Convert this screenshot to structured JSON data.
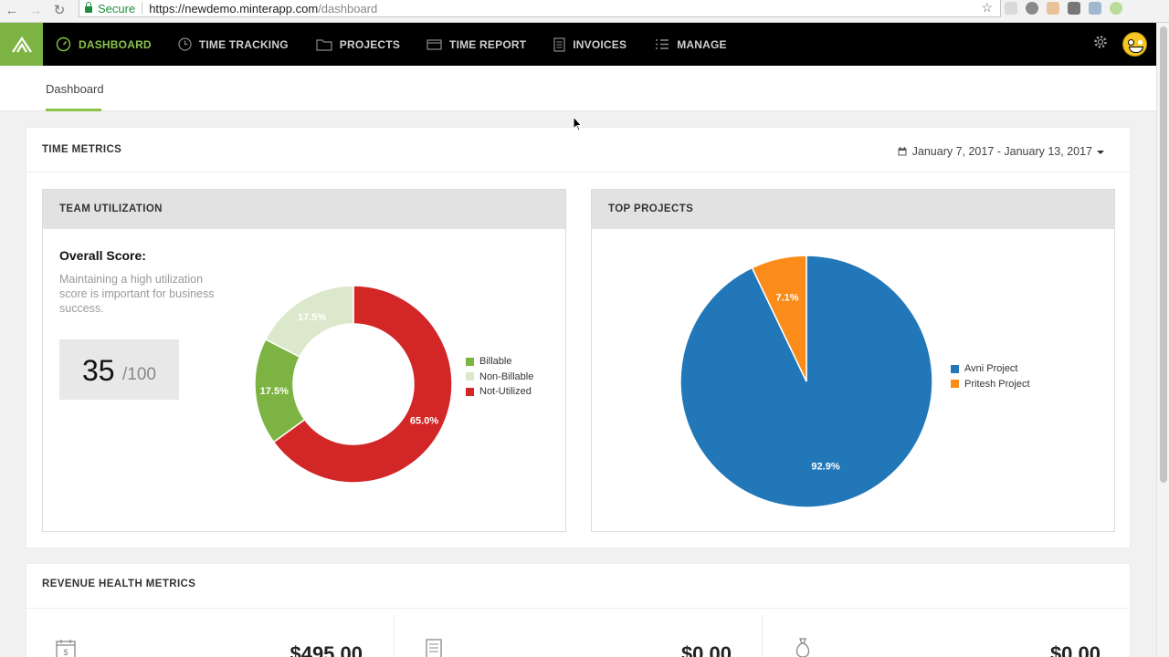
{
  "browser": {
    "secure_label": "Secure",
    "url_host": "https://newdemo.minterapp.com",
    "url_path": "/dashboard"
  },
  "nav": {
    "items": [
      {
        "label": "DASHBOARD",
        "icon": "gauge-icon"
      },
      {
        "label": "TIME TRACKING",
        "icon": "clock-icon"
      },
      {
        "label": "PROJECTS",
        "icon": "folder-icon"
      },
      {
        "label": "TIME REPORT",
        "icon": "card-icon"
      },
      {
        "label": "INVOICES",
        "icon": "document-icon"
      },
      {
        "label": "MANAGE",
        "icon": "list-icon"
      }
    ],
    "active": "DASHBOARD"
  },
  "subnav": {
    "tab": "Dashboard"
  },
  "time_metrics": {
    "title": "TIME METRICS",
    "date_range": "January 7, 2017 - January 13, 2017"
  },
  "team_utilization": {
    "title": "TEAM UTILIZATION",
    "score_title": "Overall Score:",
    "score_desc": "Maintaining a high utilization score is important for business success.",
    "score": "35",
    "score_max": "/100"
  },
  "top_projects": {
    "title": "TOP PROJECTS"
  },
  "revenue": {
    "title": "REVENUE HEALTH METRICS",
    "amounts": [
      "$495.00",
      "$0.00",
      "$0.00"
    ]
  },
  "colors": {
    "accent": "#8bc34a",
    "billable": "#7cb342",
    "non_billable": "#dce8cc",
    "not_utilized": "#d32626",
    "avni": "#2177b8",
    "pritesh": "#fb8c1a"
  },
  "chart_data": [
    {
      "type": "pie",
      "variant": "donut",
      "labels": [
        "Billable",
        "Non-Billable",
        "Not-Utilized"
      ],
      "values": [
        17.5,
        17.5,
        65.0
      ],
      "value_labels": [
        "17.5%",
        "17.5%",
        "65.0%"
      ],
      "colors": [
        "#7cb342",
        "#dce8cc",
        "#d32626"
      ],
      "legend": "right"
    },
    {
      "type": "pie",
      "labels": [
        "Avni Project",
        "Pritesh Project"
      ],
      "values": [
        92.9,
        7.1
      ],
      "value_labels": [
        "92.9%",
        "7.1%"
      ],
      "colors": [
        "#2177b8",
        "#fb8c1a"
      ],
      "legend": "right"
    }
  ]
}
